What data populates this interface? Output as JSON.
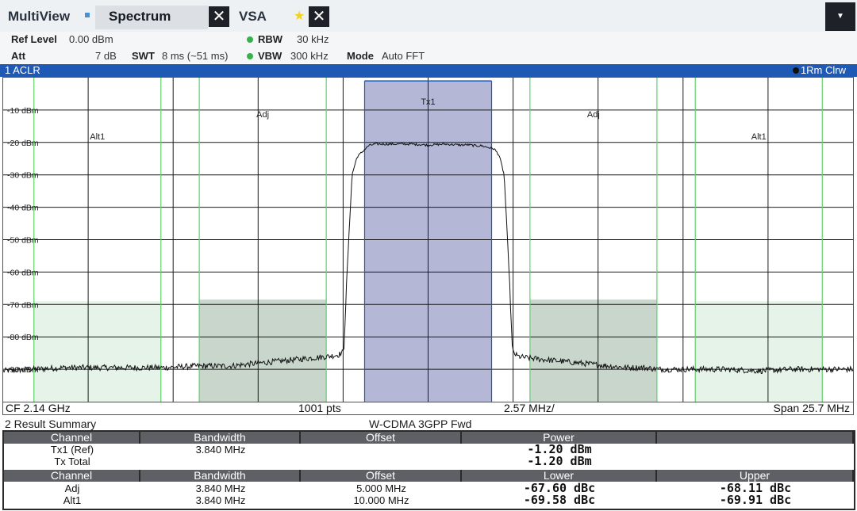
{
  "tabs": {
    "multiview": "MultiView",
    "spectrum": "Spectrum",
    "vsa": "VSA",
    "close_glyph": "✕",
    "star_glyph": "★",
    "menu_glyph": "▼"
  },
  "settings": {
    "ref_level_label": "Ref Level",
    "ref_level_value": "0.00 dBm",
    "att_label": "Att",
    "att_value": "7 dB",
    "swt_label": "SWT",
    "swt_value": "8 ms (~51 ms)",
    "rbw_label": "RBW",
    "rbw_value": "30 kHz",
    "vbw_label": "VBW",
    "vbw_value": "300 kHz",
    "mode_label": "Mode",
    "mode_value": "Auto FFT",
    "indicator_color": "#35b24a"
  },
  "aclr_window": {
    "title": "1 ACLR",
    "trace_info": "1Rm Clrw"
  },
  "chart_data": {
    "type": "line",
    "y_ticks": [
      "-10 dBm",
      "-20 dBm",
      "-30 dBm",
      "-40 dBm",
      "-50 dBm",
      "-60 dBm",
      "-70 dBm",
      "-80 dBm",
      "-90 dBm"
    ],
    "ylim": [
      -100,
      0
    ],
    "xlim_mhz": [
      -12.85,
      12.85
    ],
    "grid": true,
    "channels": [
      {
        "label": "Alt1",
        "center_mhz": -10.0,
        "bandwidth_mhz": 3.84,
        "limit_dbm": -69.0
      },
      {
        "label": "Adj",
        "center_mhz": -5.0,
        "bandwidth_mhz": 3.84,
        "limit_dbm": -68.5
      },
      {
        "label": "Tx1",
        "center_mhz": 0.0,
        "bandwidth_mhz": 3.84,
        "limit_dbm": -1.0
      },
      {
        "label": "Adj",
        "center_mhz": 5.0,
        "bandwidth_mhz": 3.84,
        "limit_dbm": -68.5
      },
      {
        "label": "Alt1",
        "center_mhz": 10.0,
        "bandwidth_mhz": 3.84,
        "limit_dbm": -69.0
      }
    ],
    "trace": {
      "x_mhz": [
        -12.85,
        -12.0,
        -11.0,
        -10.0,
        -9.0,
        -8.0,
        -7.0,
        -6.5,
        -6.0,
        -5.5,
        -5.0,
        -4.5,
        -4.0,
        -3.5,
        -3.0,
        -2.7,
        -2.55,
        -2.45,
        -2.3,
        -2.15,
        -2.0,
        -1.8,
        -1.6,
        -1.4,
        -1.2,
        -1.0,
        -0.5,
        0.0,
        0.5,
        1.0,
        1.2,
        1.4,
        1.6,
        1.8,
        2.0,
        2.15,
        2.3,
        2.45,
        2.55,
        2.7,
        3.0,
        3.5,
        4.0,
        4.5,
        5.0,
        5.5,
        6.0,
        6.5,
        7.0,
        8.0,
        9.0,
        10.0,
        11.0,
        12.0,
        12.85
      ],
      "y_dbm": [
        -90.5,
        -90.0,
        -89.5,
        -89.5,
        -89.5,
        -89.5,
        -89.0,
        -89.0,
        -89.0,
        -88.5,
        -88.0,
        -87.5,
        -87.0,
        -86.5,
        -86.0,
        -85.5,
        -84.5,
        -60.0,
        -30.0,
        -24.5,
        -23.0,
        -21.0,
        -20.5,
        -20.5,
        -20.5,
        -20.5,
        -20.5,
        -20.8,
        -20.5,
        -20.8,
        -20.7,
        -21.0,
        -21.0,
        -21.5,
        -22.0,
        -24.0,
        -30.0,
        -60.0,
        -84.5,
        -86.0,
        -86.5,
        -87.0,
        -87.5,
        -88.0,
        -88.5,
        -89.0,
        -89.5,
        -89.5,
        -90.0,
        -90.0,
        -90.0,
        -90.5,
        -90.0,
        -90.0,
        -90.0
      ]
    }
  },
  "status": {
    "cf": "CF 2.14 GHz",
    "points": "1001 pts",
    "per_div": "2.57 MHz/",
    "span": "Span 25.7 MHz"
  },
  "result_summary": {
    "title": "2 Result Summary",
    "standard": "W-CDMA 3GPP Fwd",
    "header1": [
      "Channel",
      "Bandwidth",
      "Offset",
      "Power",
      ""
    ],
    "tx_row": [
      "Tx1 (Ref)",
      "3.840 MHz",
      "",
      "-1.20 dBm",
      ""
    ],
    "total_row": [
      "Tx Total",
      "",
      "",
      "-1.20 dBm",
      ""
    ],
    "header2": [
      "Channel",
      "Bandwidth",
      "Offset",
      "Lower",
      "Upper"
    ],
    "adj_row": [
      "Adj",
      "3.840 MHz",
      "5.000 MHz",
      "-67.60 dBc",
      "-68.11 dBc"
    ],
    "alt_row": [
      "Alt1",
      "3.840 MHz",
      "10.000 MHz",
      "-69.58 dBc",
      "-69.91 dBc"
    ]
  },
  "colors": {
    "window_accent": "#1e5ab5",
    "tx_band": "#b4b8d6",
    "adj_band": "#c9d6cc",
    "alt_band": "#e6f3e9",
    "channel_line": "#5fd06a",
    "grid": "#1b1b1b",
    "trace": "#111111"
  }
}
